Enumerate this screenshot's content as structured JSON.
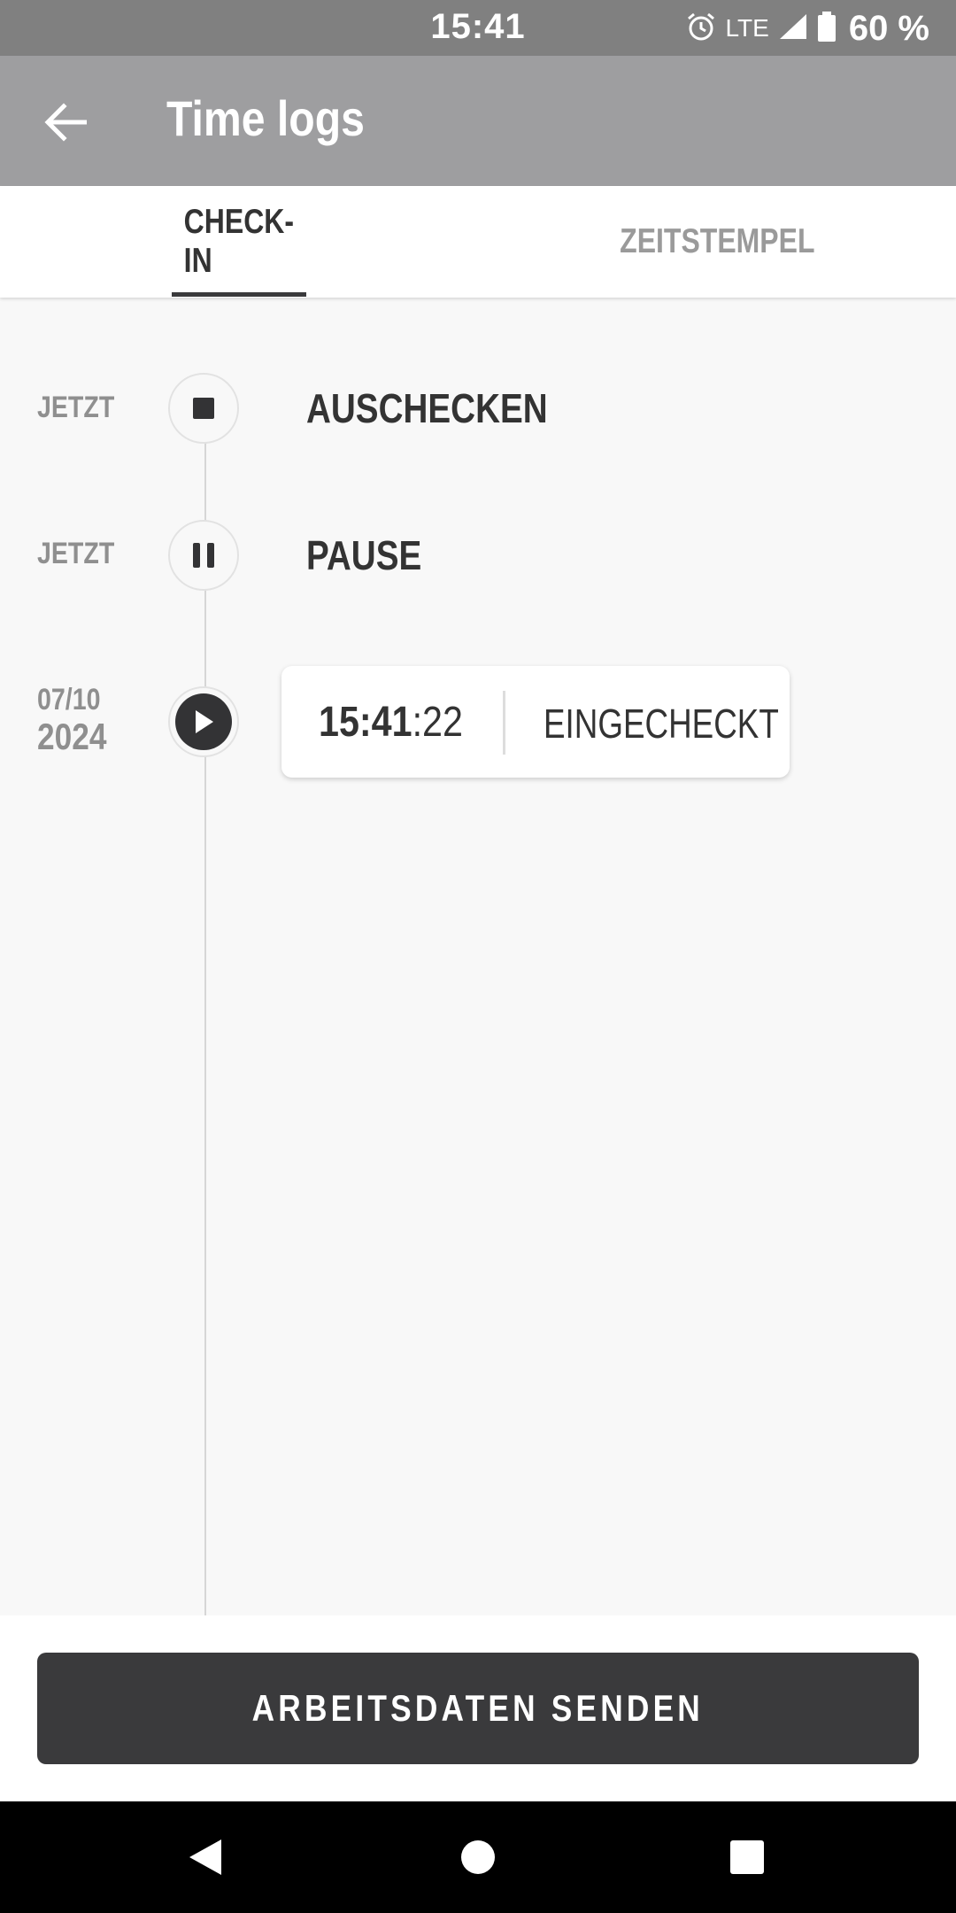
{
  "status_bar": {
    "time": "15:41",
    "network": "LTE",
    "battery": "60 %"
  },
  "app_bar": {
    "title": "Time logs"
  },
  "tabs": [
    {
      "label": "CHECK-IN",
      "active": true
    },
    {
      "label": "ZEITSTEMPEL",
      "active": false
    }
  ],
  "timeline": {
    "items": [
      {
        "date": "JETZT",
        "action": "AUSCHECKEN",
        "icon": "stop-icon"
      },
      {
        "date": "JETZT",
        "action": "PAUSE",
        "icon": "pause-icon"
      },
      {
        "date_line1": "07/10",
        "date_line2": "2024",
        "icon": "play-icon",
        "card": {
          "time_hm": "15:41",
          "time_s": ":22",
          "status": "EINGECHECKT"
        }
      }
    ]
  },
  "send_button": {
    "label": "ARBEITSDATEN SENDEN"
  },
  "colors": {
    "status_bar": "#808080",
    "app_bar": "#9e9ea0",
    "dark": "#3a3a3c",
    "background": "#f8f8f8"
  }
}
